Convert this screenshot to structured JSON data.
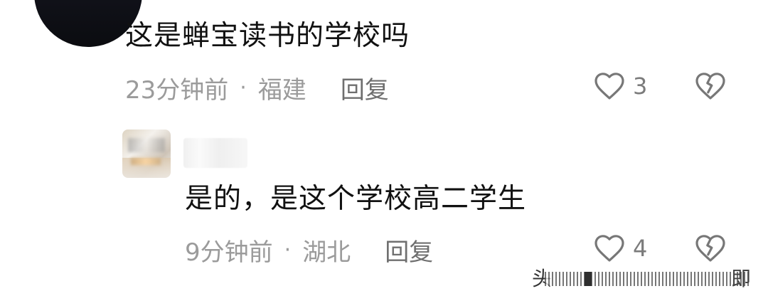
{
  "comment": {
    "text": "这是蝉宝读书的学校吗",
    "time": "23分钟前",
    "separator": "·",
    "location": "福建",
    "reply_label": "回复",
    "like_count": "3",
    "avatar_icon": "avatar-image",
    "like_icon": "heart-outline-icon",
    "dislike_icon": "broken-heart-icon"
  },
  "reply": {
    "text": "是的，是这个学校高二学生",
    "time": "9分钟前",
    "separator": "·",
    "location": "湖北",
    "reply_label": "回复",
    "like_count": "4",
    "avatar_icon": "blurred-avatar-image",
    "username_icon": "blurred-username",
    "like_icon": "heart-outline-icon",
    "dislike_icon": "broken-heart-icon"
  },
  "watermark": {
    "lead_text": "头",
    "tail_text": "即"
  },
  "colors": {
    "primary_text": "#111111",
    "meta_text": "#9b9b9b",
    "icon_gray": "#777777",
    "background": "#ffffff"
  }
}
